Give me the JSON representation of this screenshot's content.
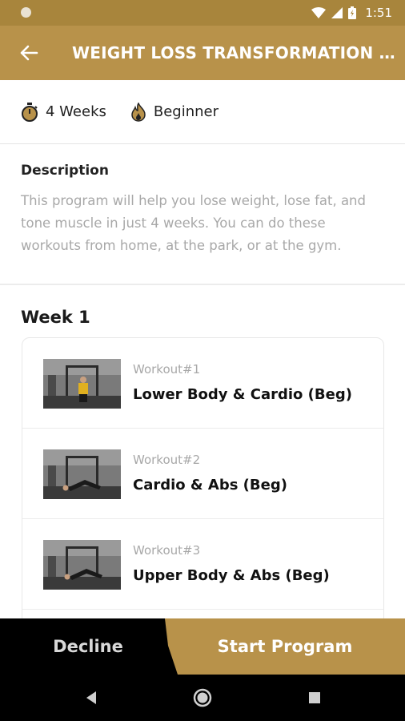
{
  "status_bar": {
    "time": "1:51"
  },
  "app_bar": {
    "title": "WEIGHT LOSS TRANSFORMATION (VOL...",
    "back_icon": "arrow-left-icon"
  },
  "meta": {
    "duration": "4 Weeks",
    "level": "Beginner",
    "duration_icon": "stopwatch-icon",
    "level_icon": "flame-icon"
  },
  "description": {
    "heading": "Description",
    "body": "This program will help you lose weight, lose fat, and tone muscle in just 4 weeks. You can do these workouts from home, at the park, or at the gym."
  },
  "week": {
    "heading": "Week 1",
    "workouts": [
      {
        "number": "Workout#1",
        "name": "Lower Body & Cardio (Beg)"
      },
      {
        "number": "Workout#2",
        "name": "Cardio & Abs (Beg)"
      },
      {
        "number": "Workout#3",
        "name": "Upper Body & Abs (Beg)"
      }
    ]
  },
  "actions": {
    "decline": "Decline",
    "start": "Start Program"
  },
  "colors": {
    "accent": "#b8924a",
    "status_bar": "#a8853c",
    "bottom_bar": "#000000"
  }
}
